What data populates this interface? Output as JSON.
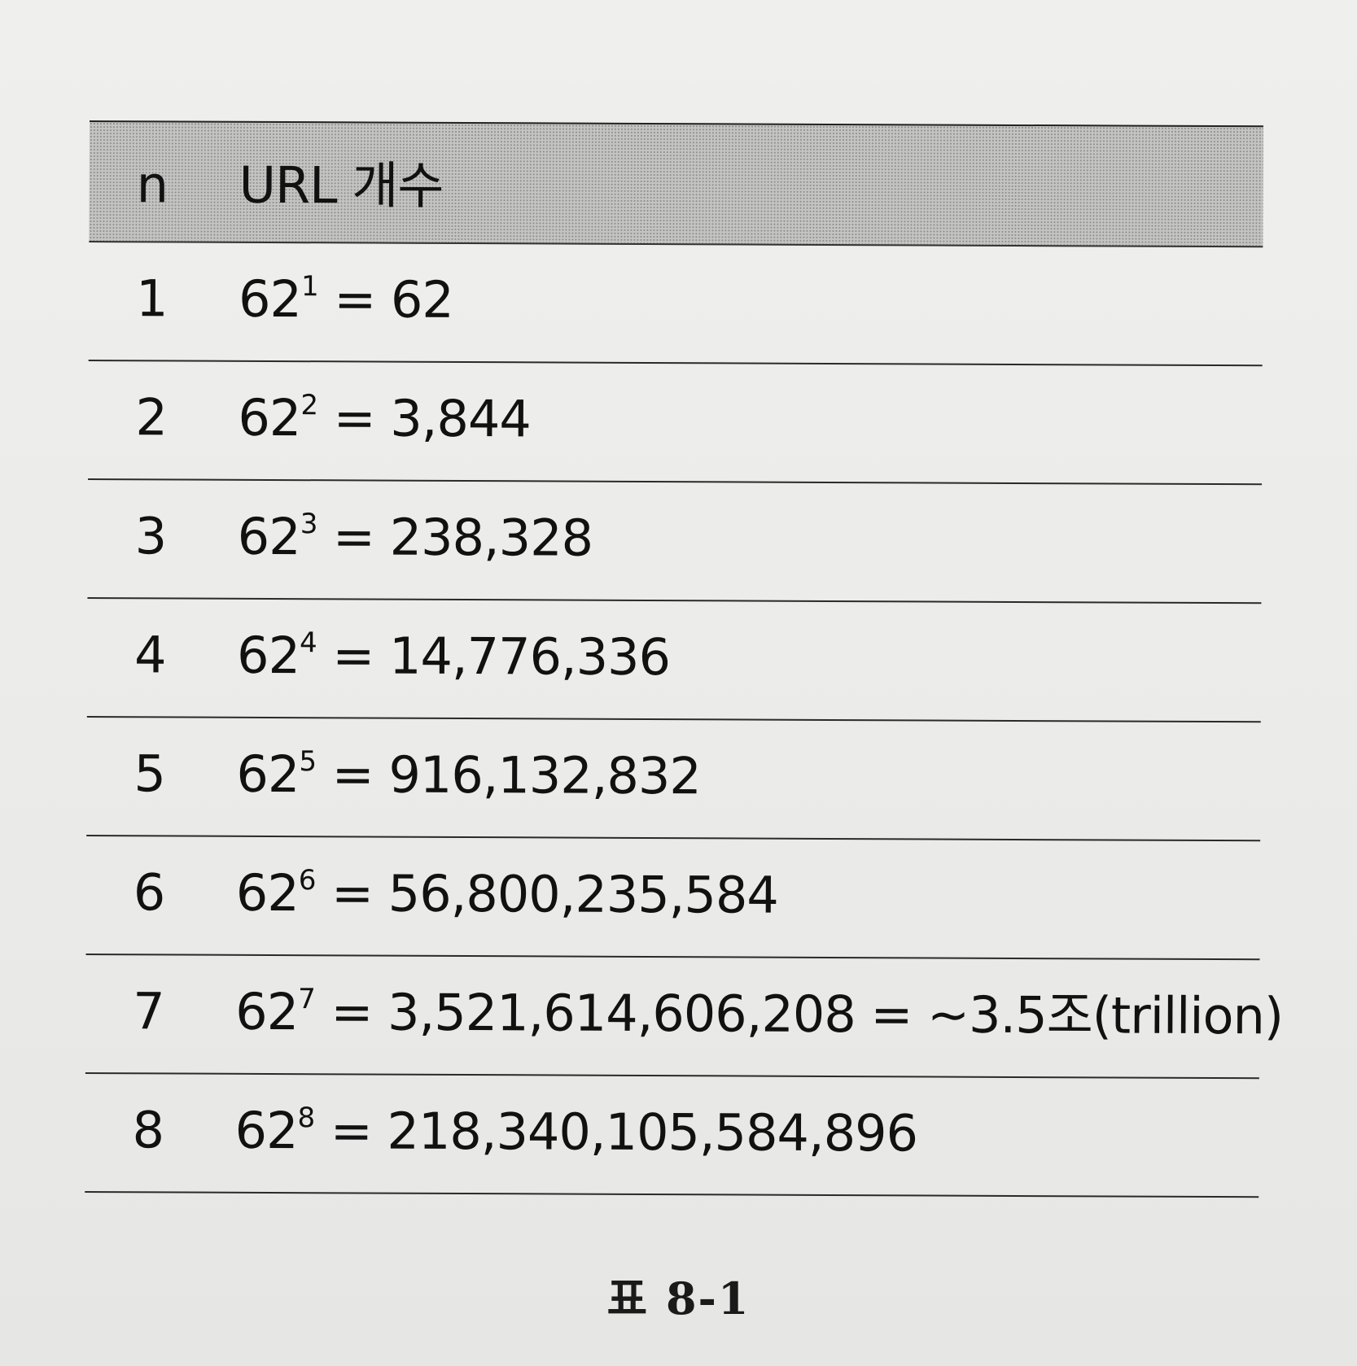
{
  "table": {
    "header": {
      "n": "n",
      "value": "URL 개수"
    },
    "rows": [
      {
        "n": "1",
        "base": "62",
        "exp": "1",
        "rest": " = 62"
      },
      {
        "n": "2",
        "base": "62",
        "exp": "2",
        "rest": " = 3,844"
      },
      {
        "n": "3",
        "base": "62",
        "exp": "3",
        "rest": " = 238,328"
      },
      {
        "n": "4",
        "base": "62",
        "exp": "4",
        "rest": " = 14,776,336"
      },
      {
        "n": "5",
        "base": "62",
        "exp": "5",
        "rest": " = 916,132,832"
      },
      {
        "n": "6",
        "base": "62",
        "exp": "6",
        "rest": " = 56,800,235,584"
      },
      {
        "n": "7",
        "base": "62",
        "exp": "7",
        "rest": " = 3,521,614,606,208 = ~3.5조(trillion)"
      },
      {
        "n": "8",
        "base": "62",
        "exp": "8",
        "rest": " = 218,340,105,584,896"
      }
    ]
  },
  "caption": "표 8-1",
  "colors": {
    "paper": "#ececea",
    "header_fill": "#c4c4c2",
    "rule": "#222222",
    "text": "#111111"
  }
}
